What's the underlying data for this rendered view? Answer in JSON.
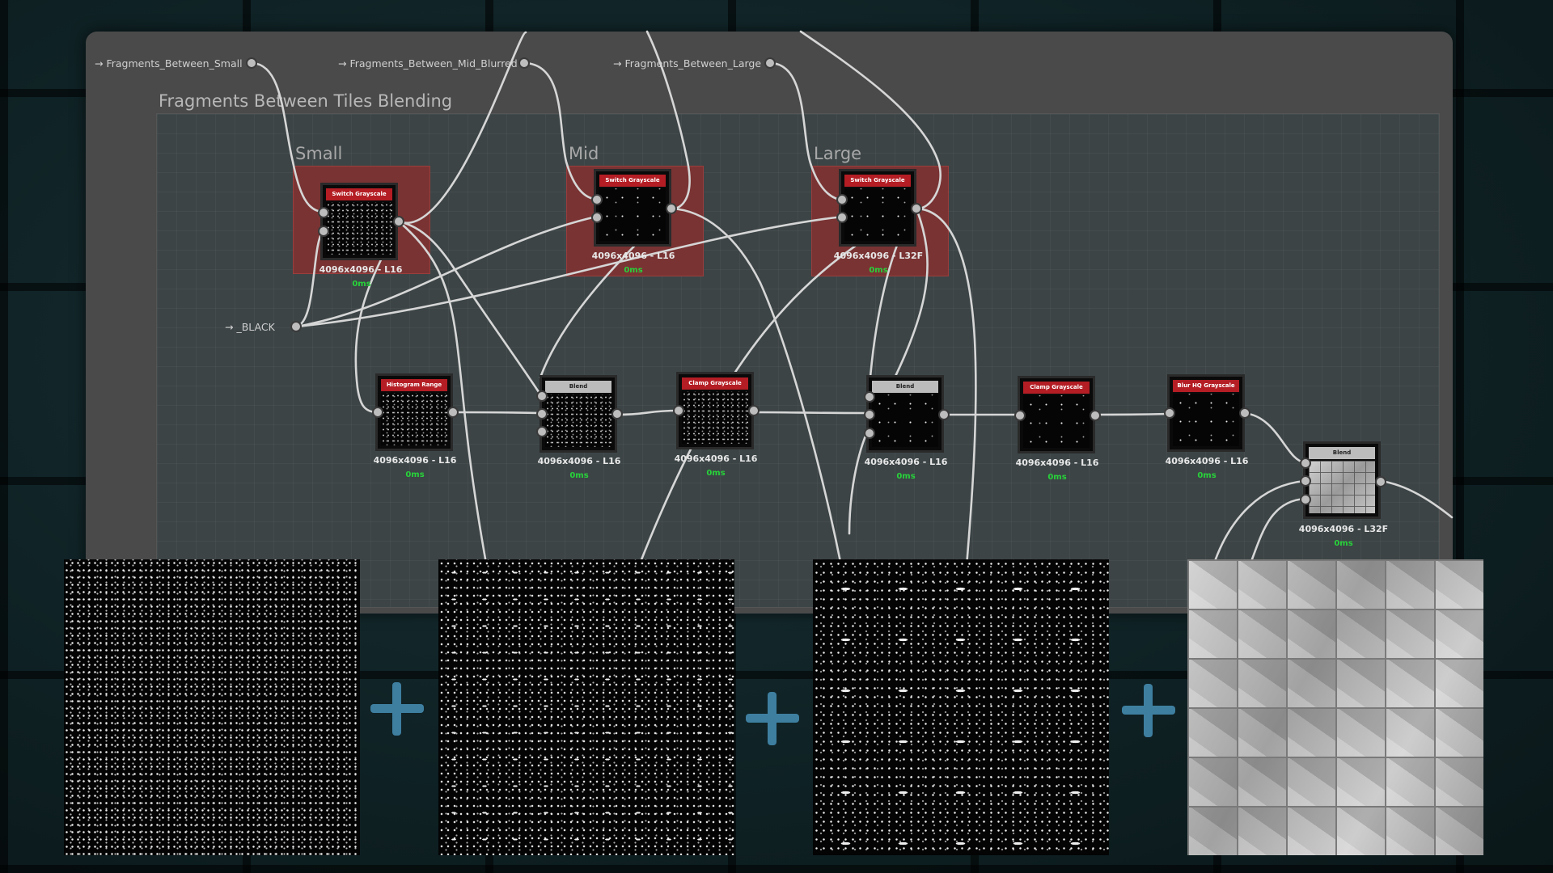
{
  "graph": {
    "frame_title": "Fragments Between Tiles Blending",
    "groups": [
      {
        "label": "Small"
      },
      {
        "label": "Mid"
      },
      {
        "label": "Large"
      }
    ],
    "inputs": [
      {
        "label": "→ Fragments_Between_Small"
      },
      {
        "label": "→ Fragments_Between_Mid_Blurred"
      },
      {
        "label": "→ Fragments_Between_Large"
      },
      {
        "label": "→ _BLACK"
      }
    ],
    "nodes": [
      {
        "title": "Switch Grayscale",
        "res": "4096x4096 - L16",
        "time": "0ms"
      },
      {
        "title": "Switch Grayscale",
        "res": "4096x4096 - L16",
        "time": "0ms"
      },
      {
        "title": "Switch Grayscale",
        "res": "4096x4096 - L32F",
        "time": "0ms"
      },
      {
        "title": "Histogram Range",
        "res": "4096x4096 - L16",
        "time": "0ms"
      },
      {
        "title": "Blend",
        "res": "4096x4096 - L16",
        "time": "0ms"
      },
      {
        "title": "Clamp Grayscale",
        "res": "4096x4096 - L16",
        "time": "0ms"
      },
      {
        "title": "Blend",
        "res": "4096x4096 - L16",
        "time": "0ms"
      },
      {
        "title": "Clamp Grayscale",
        "res": "4096x4096 - L16",
        "time": "0ms"
      },
      {
        "title": "Blur HQ Grayscale",
        "res": "4096x4096 - L16",
        "time": "0ms"
      },
      {
        "title": "Blend",
        "res": "4096x4096 - L32F",
        "time": "0ms"
      }
    ]
  },
  "previews": [
    {
      "name": "small-fragments"
    },
    {
      "name": "mid-fragments"
    },
    {
      "name": "large-fragments"
    },
    {
      "name": "blended-tiles"
    }
  ],
  "colors": {
    "node_header": "#b41d24",
    "group_fill": "#7a3333",
    "time_text": "#28d23a",
    "plus_sign": "#3e7fa0"
  },
  "icons": [
    "plus-icon",
    "input-socket-icon"
  ]
}
